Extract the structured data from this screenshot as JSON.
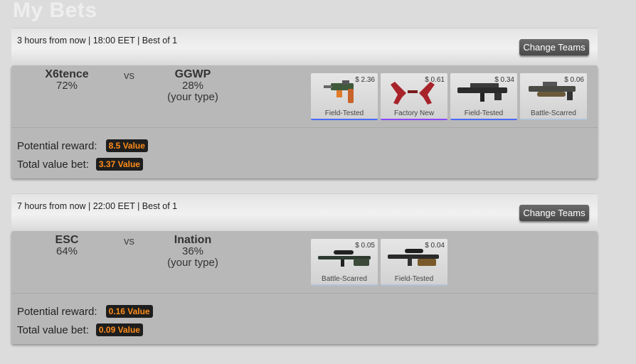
{
  "page": {
    "title": "My Bets"
  },
  "matches": [
    {
      "time": "3 hours from now | 18:00 EET | Best of 1",
      "change_label": "Change Teams",
      "team1": {
        "name": "X6tence",
        "pct": "72%"
      },
      "vs": "vs",
      "team2": {
        "name": "GGWP",
        "pct": "28%",
        "note": "(your type)"
      },
      "items": [
        {
          "price": "$ 2.36",
          "wear": "Field-Tested",
          "icon": "tec9-pistol-icon",
          "rarity_color": "#4b69ff"
        },
        {
          "price": "$ 0.61",
          "wear": "Factory New",
          "icon": "dual-berettas-icon",
          "rarity_color": "#8847ff"
        },
        {
          "price": "$ 0.34",
          "wear": "Field-Tested",
          "icon": "famas-rifle-icon",
          "rarity_color": "#4b69ff"
        },
        {
          "price": "$ 0.06",
          "wear": "Battle-Scarred",
          "icon": "pp-bizon-smg-icon",
          "rarity_color": "#b0c3d9"
        }
      ],
      "potential_label": "Potential reward:",
      "potential_value": "8.5 Value",
      "total_label": "Total value bet:",
      "total_value": "3.37 Value"
    },
    {
      "time": "7 hours from now | 22:00 EET | Best of 1",
      "change_label": "Change Teams",
      "team1": {
        "name": "ESC",
        "pct": "64%"
      },
      "vs": "vs",
      "team2": {
        "name": "Ination",
        "pct": "36%",
        "note": "(your type)"
      },
      "items": [
        {
          "price": "$ 0.05",
          "wear": "Battle-Scarred",
          "icon": "awp-sniper-icon",
          "rarity_color": "#b0c3d9"
        },
        {
          "price": "$ 0.04",
          "wear": "Field-Tested",
          "icon": "scar-sniper-icon",
          "rarity_color": "#b0c3d9"
        }
      ],
      "potential_label": "Potential reward:",
      "potential_value": "0.16 Value",
      "total_label": "Total value bet:",
      "total_value": "0.09 Value"
    }
  ]
}
